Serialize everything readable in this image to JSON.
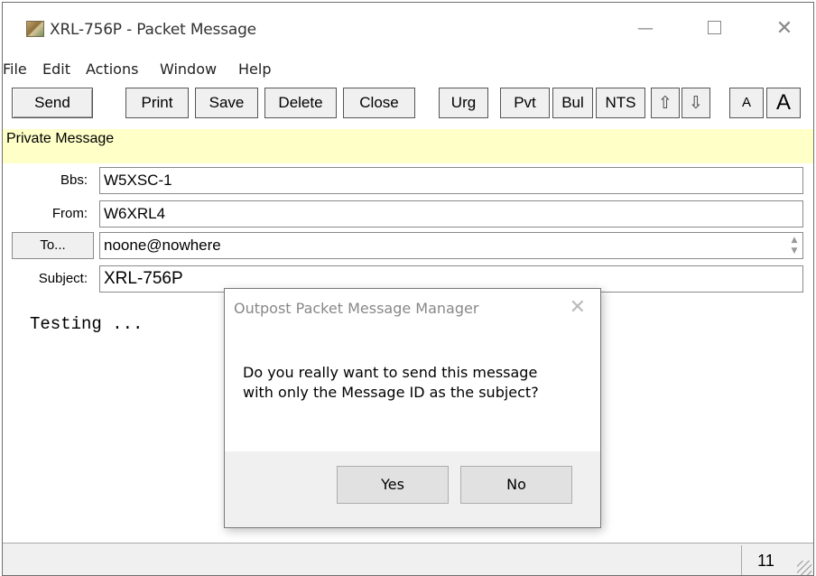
{
  "window": {
    "title": "XRL-756P - Packet Message",
    "minimize_glyph": "—",
    "close_glyph": "✕"
  },
  "menu": {
    "items": [
      {
        "label": "File"
      },
      {
        "label": "Edit"
      },
      {
        "label": "Actions"
      },
      {
        "label": "Window"
      },
      {
        "label": "Help"
      }
    ]
  },
  "toolbar": {
    "send": "Send",
    "print": "Print",
    "save": "Save",
    "delete": "Delete",
    "close": "Close",
    "urg": "Urg",
    "pvt": "Pvt",
    "bul": "Bul",
    "nts": "NTS",
    "up_glyph": "⇧",
    "down_glyph": "⇩",
    "font_small": "A",
    "font_large": "A"
  },
  "message_type": "Private Message",
  "fields": {
    "bbs_label": "Bbs:",
    "bbs_value": "W5XSC-1",
    "from_label": "From:",
    "from_value": "W6XRL4",
    "to_button": "To...",
    "to_value": "noone@nowhere",
    "subject_label": "Subject:",
    "subject_value": "XRL-756P"
  },
  "body_text": "Testing ...",
  "status": {
    "count": "11"
  },
  "dialog": {
    "title": "Outpost Packet Message Manager",
    "close_glyph": "✕",
    "message_line1": "Do you really want to send this message",
    "message_line2": "with only the Message ID as the subject?",
    "yes": "Yes",
    "no": "No"
  },
  "colors": {
    "message_type_bg": "#ffffc8",
    "button_face": "#f0f0f0"
  },
  "icons": {
    "app": "app-icon",
    "up": "up-arrow-icon",
    "down": "down-arrow-icon",
    "resize": "resize-grip-icon"
  }
}
